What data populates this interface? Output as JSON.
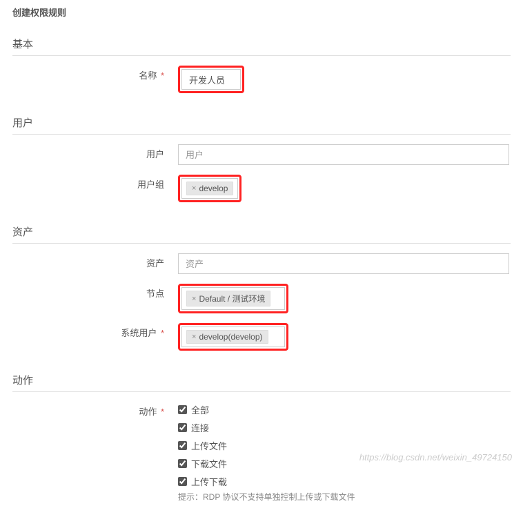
{
  "page_title": "创建权限规则",
  "sections": {
    "basic": {
      "header": "基本",
      "name_label": "名称",
      "name_value": "开发人员"
    },
    "user": {
      "header": "用户",
      "user_label": "用户",
      "user_placeholder": "用户",
      "group_label": "用户组",
      "group_tag": "develop"
    },
    "asset": {
      "header": "资产",
      "asset_label": "资产",
      "asset_placeholder": "资产",
      "node_label": "节点",
      "node_tag": "Default / 测试环境",
      "sysuser_label": "系统用户",
      "sysuser_tag": "develop(develop)"
    },
    "action": {
      "header": "动作",
      "action_label": "动作",
      "options": {
        "all": "全部",
        "connect": "连接",
        "upload": "上传文件",
        "download": "下载文件",
        "updown": "上传下载"
      },
      "help_text": "提示：RDP 协议不支持单独控制上传或下载文件"
    }
  },
  "watermark": "https://blog.csdn.net/weixin_49724150"
}
